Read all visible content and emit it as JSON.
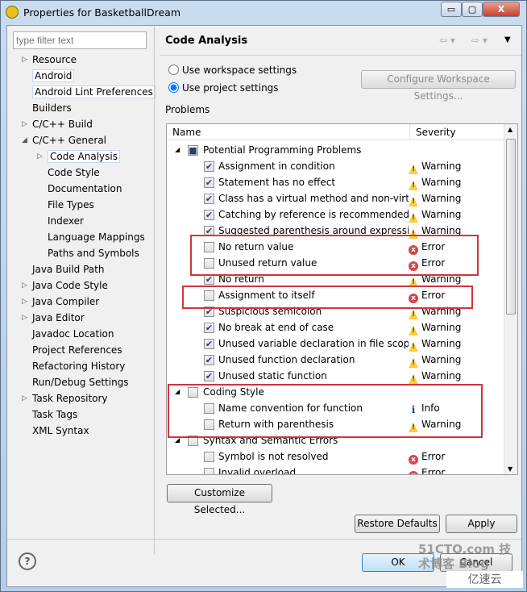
{
  "window": {
    "title": "Properties for BasketballDream",
    "minimize": "▭",
    "maximize": "▢",
    "close": "X"
  },
  "filter": {
    "placeholder": "type filter text"
  },
  "tree": [
    {
      "label": "Resource",
      "level": 0,
      "expander": "▷"
    },
    {
      "label": "Android",
      "level": 0,
      "selected": true
    },
    {
      "label": "Android Lint Preferences",
      "level": 0,
      "selected": true
    },
    {
      "label": "Builders",
      "level": 0
    },
    {
      "label": "C/C++ Build",
      "level": 0,
      "expander": "▷"
    },
    {
      "label": "C/C++ General",
      "level": 0,
      "expander": "◢"
    },
    {
      "label": "Code Analysis",
      "level": 1,
      "expander": "▷",
      "selected": true
    },
    {
      "label": "Code Style",
      "level": 1
    },
    {
      "label": "Documentation",
      "level": 1
    },
    {
      "label": "File Types",
      "level": 1
    },
    {
      "label": "Indexer",
      "level": 1
    },
    {
      "label": "Language Mappings",
      "level": 1
    },
    {
      "label": "Paths and Symbols",
      "level": 1
    },
    {
      "label": "Java Build Path",
      "level": 0
    },
    {
      "label": "Java Code Style",
      "level": 0,
      "expander": "▷"
    },
    {
      "label": "Java Compiler",
      "level": 0,
      "expander": "▷"
    },
    {
      "label": "Java Editor",
      "level": 0,
      "expander": "▷"
    },
    {
      "label": "Javadoc Location",
      "level": 0
    },
    {
      "label": "Project References",
      "level": 0
    },
    {
      "label": "Refactoring History",
      "level": 0
    },
    {
      "label": "Run/Debug Settings",
      "level": 0
    },
    {
      "label": "Task Repository",
      "level": 0,
      "expander": "▷"
    },
    {
      "label": "Task Tags",
      "level": 0
    },
    {
      "label": "XML Syntax",
      "level": 0
    }
  ],
  "page": {
    "title": "Code Analysis",
    "nav_back": "⇦ ▾",
    "nav_fwd": "⇨ ▾",
    "menu": "▼",
    "radio_workspace": "Use workspace settings",
    "radio_project": "Use project settings",
    "selected_radio": "project",
    "configure_button": "Configure Workspace Settings...",
    "problems_label": "Problems"
  },
  "table": {
    "col_name": "Name",
    "col_severity": "Severity",
    "rows": [
      {
        "type": "category",
        "label": "Potential Programming Problems",
        "check": "■",
        "expander": "◢"
      },
      {
        "label": "Assignment in condition",
        "check": "✔",
        "severity": "Warning",
        "icon": "warning"
      },
      {
        "label": "Statement has no effect",
        "check": "✔",
        "severity": "Warning",
        "icon": "warning"
      },
      {
        "label": "Class has a virtual method and non-virtual destructor",
        "check": "✔",
        "severity": "Warning",
        "icon": "warning"
      },
      {
        "label": "Catching by reference is recommended",
        "check": "✔",
        "severity": "Warning",
        "icon": "warning"
      },
      {
        "label": "Suggested parenthesis around expression",
        "check": "✔",
        "severity": "Warning",
        "icon": "warning"
      },
      {
        "label": "No return value",
        "check": "",
        "severity": "Error",
        "icon": "error"
      },
      {
        "label": "Unused return value",
        "check": "",
        "severity": "Error",
        "icon": "error"
      },
      {
        "label": "No return",
        "check": "✔",
        "severity": "Warning",
        "icon": "warning"
      },
      {
        "label": "Assignment to itself",
        "check": "",
        "severity": "Error",
        "icon": "error"
      },
      {
        "label": "Suspicious semicolon",
        "check": "✔",
        "severity": "Warning",
        "icon": "warning"
      },
      {
        "label": "No break at end of case",
        "check": "✔",
        "severity": "Warning",
        "icon": "warning"
      },
      {
        "label": "Unused variable declaration in file scope",
        "check": "✔",
        "severity": "Warning",
        "icon": "warning"
      },
      {
        "label": "Unused function declaration",
        "check": "✔",
        "severity": "Warning",
        "icon": "warning"
      },
      {
        "label": "Unused static function",
        "check": "✔",
        "severity": "Warning",
        "icon": "warning"
      },
      {
        "type": "category",
        "label": "Coding Style",
        "check": "",
        "expander": "◢"
      },
      {
        "label": "Name convention for function",
        "check": "",
        "severity": "Info",
        "icon": "info"
      },
      {
        "label": "Return with parenthesis",
        "check": "",
        "severity": "Warning",
        "icon": "warning"
      },
      {
        "type": "category",
        "label": "Syntax and Semantic Errors",
        "check": "",
        "expander": "◢"
      },
      {
        "label": "Symbol is not resolved",
        "check": "",
        "severity": "Error",
        "icon": "error"
      },
      {
        "label": "Invalid overload",
        "check": "",
        "severity": "Error",
        "icon": "error"
      }
    ]
  },
  "buttons": {
    "customize": "Customize Selected...",
    "restore": "Restore Defaults",
    "apply": "Apply",
    "ok": "OK",
    "cancel": "Cancel",
    "help": "?"
  },
  "watermark": {
    "text": "51CTO.com 技术博客 Blog",
    "logo": "亿速云"
  },
  "colors": {
    "highlight": "#d2343c",
    "accent": "#3c7fb1"
  }
}
